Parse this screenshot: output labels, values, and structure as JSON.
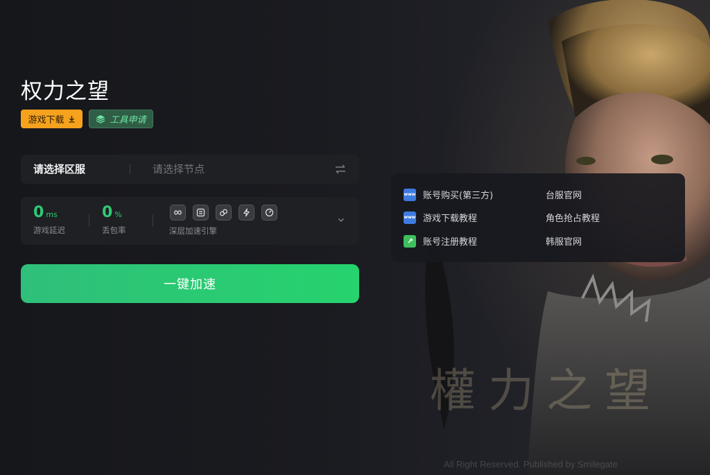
{
  "game": {
    "title": "权力之望",
    "download_tag": "游戏下载",
    "tool_tag": "工具申请"
  },
  "selector": {
    "region_label": "请选择区服",
    "node_placeholder": "请选择节点"
  },
  "stats": {
    "latency_value": "0",
    "latency_unit": "ms",
    "latency_label": "游戏延迟",
    "loss_value": "0",
    "loss_unit": "%",
    "loss_label": "丢包率",
    "engine_label": "深层加速引擎",
    "engine_icons": [
      "loop-icon",
      "route-icon",
      "link-icon",
      "boost-icon",
      "speed-icon"
    ]
  },
  "accelerate_button": "一键加速",
  "links": {
    "account_buy": "账号购买(第三方)",
    "download_tutorial": "游戏下载教程",
    "register_tutorial": "账号注册教程",
    "tw_site": "台服官网",
    "role_tutorial": "角色抢占教程",
    "kr_site": "韩服官网",
    "www_icon_text": "www"
  },
  "background": {
    "logo_text": "權力之望",
    "copyright": "All Right Reserved. Published by Smilegate"
  },
  "colors": {
    "accent_green": "#26d36d",
    "download_orange": "#f6a21d",
    "panel_bg": "#1f2024"
  }
}
